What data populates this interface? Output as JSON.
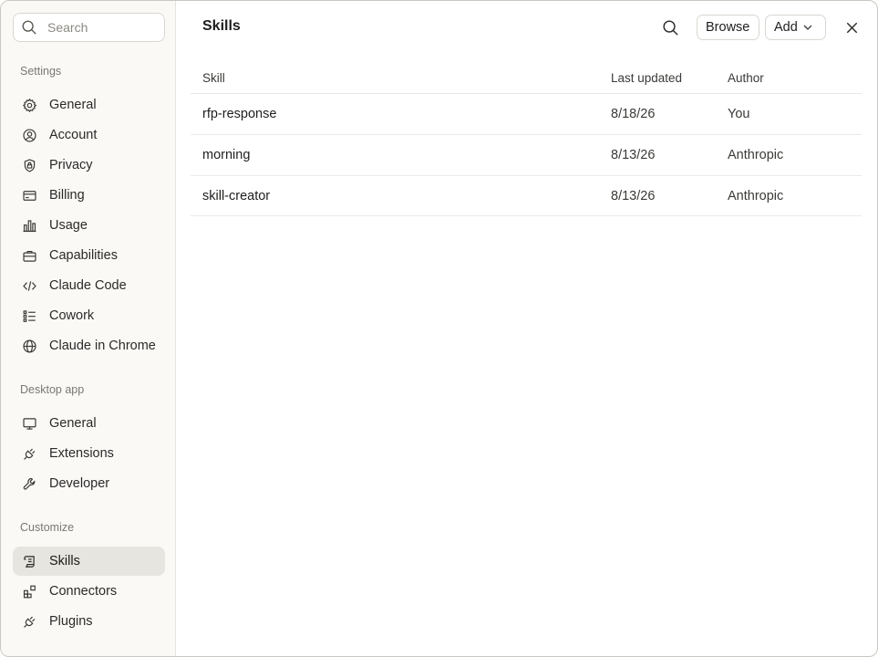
{
  "sidebar": {
    "search_placeholder": "Search",
    "sections": [
      {
        "label": "Settings",
        "items": [
          {
            "label": "General",
            "icon": "gear-icon"
          },
          {
            "label": "Account",
            "icon": "user-circle-icon"
          },
          {
            "label": "Privacy",
            "icon": "shield-lock-icon"
          },
          {
            "label": "Billing",
            "icon": "credit-card-icon"
          },
          {
            "label": "Usage",
            "icon": "bar-chart-icon"
          },
          {
            "label": "Capabilities",
            "icon": "briefcase-icon"
          },
          {
            "label": "Claude Code",
            "icon": "code-icon"
          },
          {
            "label": "Cowork",
            "icon": "checklist-icon"
          },
          {
            "label": "Claude in Chrome",
            "icon": "globe-icon"
          }
        ]
      },
      {
        "label": "Desktop app",
        "items": [
          {
            "label": "General",
            "icon": "monitor-icon"
          },
          {
            "label": "Extensions",
            "icon": "plug-icon"
          },
          {
            "label": "Developer",
            "icon": "wrench-icon"
          }
        ]
      },
      {
        "label": "Customize",
        "items": [
          {
            "label": "Skills",
            "icon": "scroll-icon",
            "active": true
          },
          {
            "label": "Connectors",
            "icon": "blocks-icon"
          },
          {
            "label": "Plugins",
            "icon": "plug-icon"
          }
        ]
      }
    ]
  },
  "main": {
    "title": "Skills",
    "browse_label": "Browse",
    "add_label": "Add",
    "columns": [
      "Skill",
      "Last updated",
      "Author"
    ],
    "rows": [
      {
        "skill": "rfp-response",
        "updated": "8/18/26",
        "author": "You"
      },
      {
        "skill": "morning",
        "updated": "8/13/26",
        "author": "Anthropic"
      },
      {
        "skill": "skill-creator",
        "updated": "8/13/26",
        "author": "Anthropic"
      }
    ]
  },
  "colors": {
    "sidebar_bg": "#faf9f6",
    "active_item_bg": "#e7e5df",
    "text": "#1f1e1d",
    "muted_text": "#7a7872"
  }
}
